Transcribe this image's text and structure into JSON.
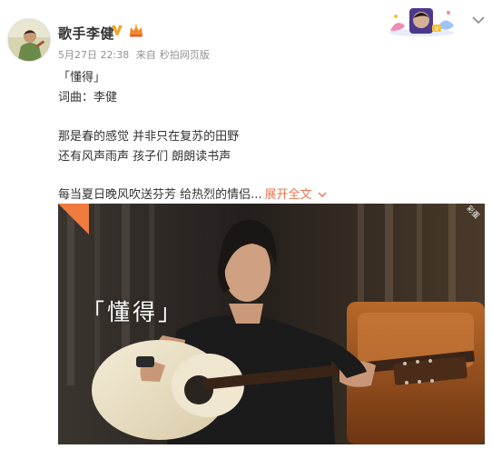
{
  "user": {
    "name": "歌手李健",
    "date": "5月27日 22:38",
    "via": "来自",
    "source": "秒拍网页版"
  },
  "post": {
    "lines": [
      "「懂得」",
      "词曲：李健",
      "那是春的感觉 并非只在复苏的田野",
      "还有风声雨声 孩子们 朗朗读书声",
      "每当夏日晚风吹送芬芳 给热烈的情侣..."
    ],
    "expand_label": "展开全文"
  },
  "video": {
    "title": "「懂得」",
    "badge": "彩蛋"
  },
  "colors": {
    "link": "#eb7350",
    "meta": "#939393",
    "text": "#333333",
    "verified": "#f5a623"
  },
  "icons": [
    "verified-icon",
    "crown-icon",
    "more-icon",
    "chevron-down-icon"
  ]
}
